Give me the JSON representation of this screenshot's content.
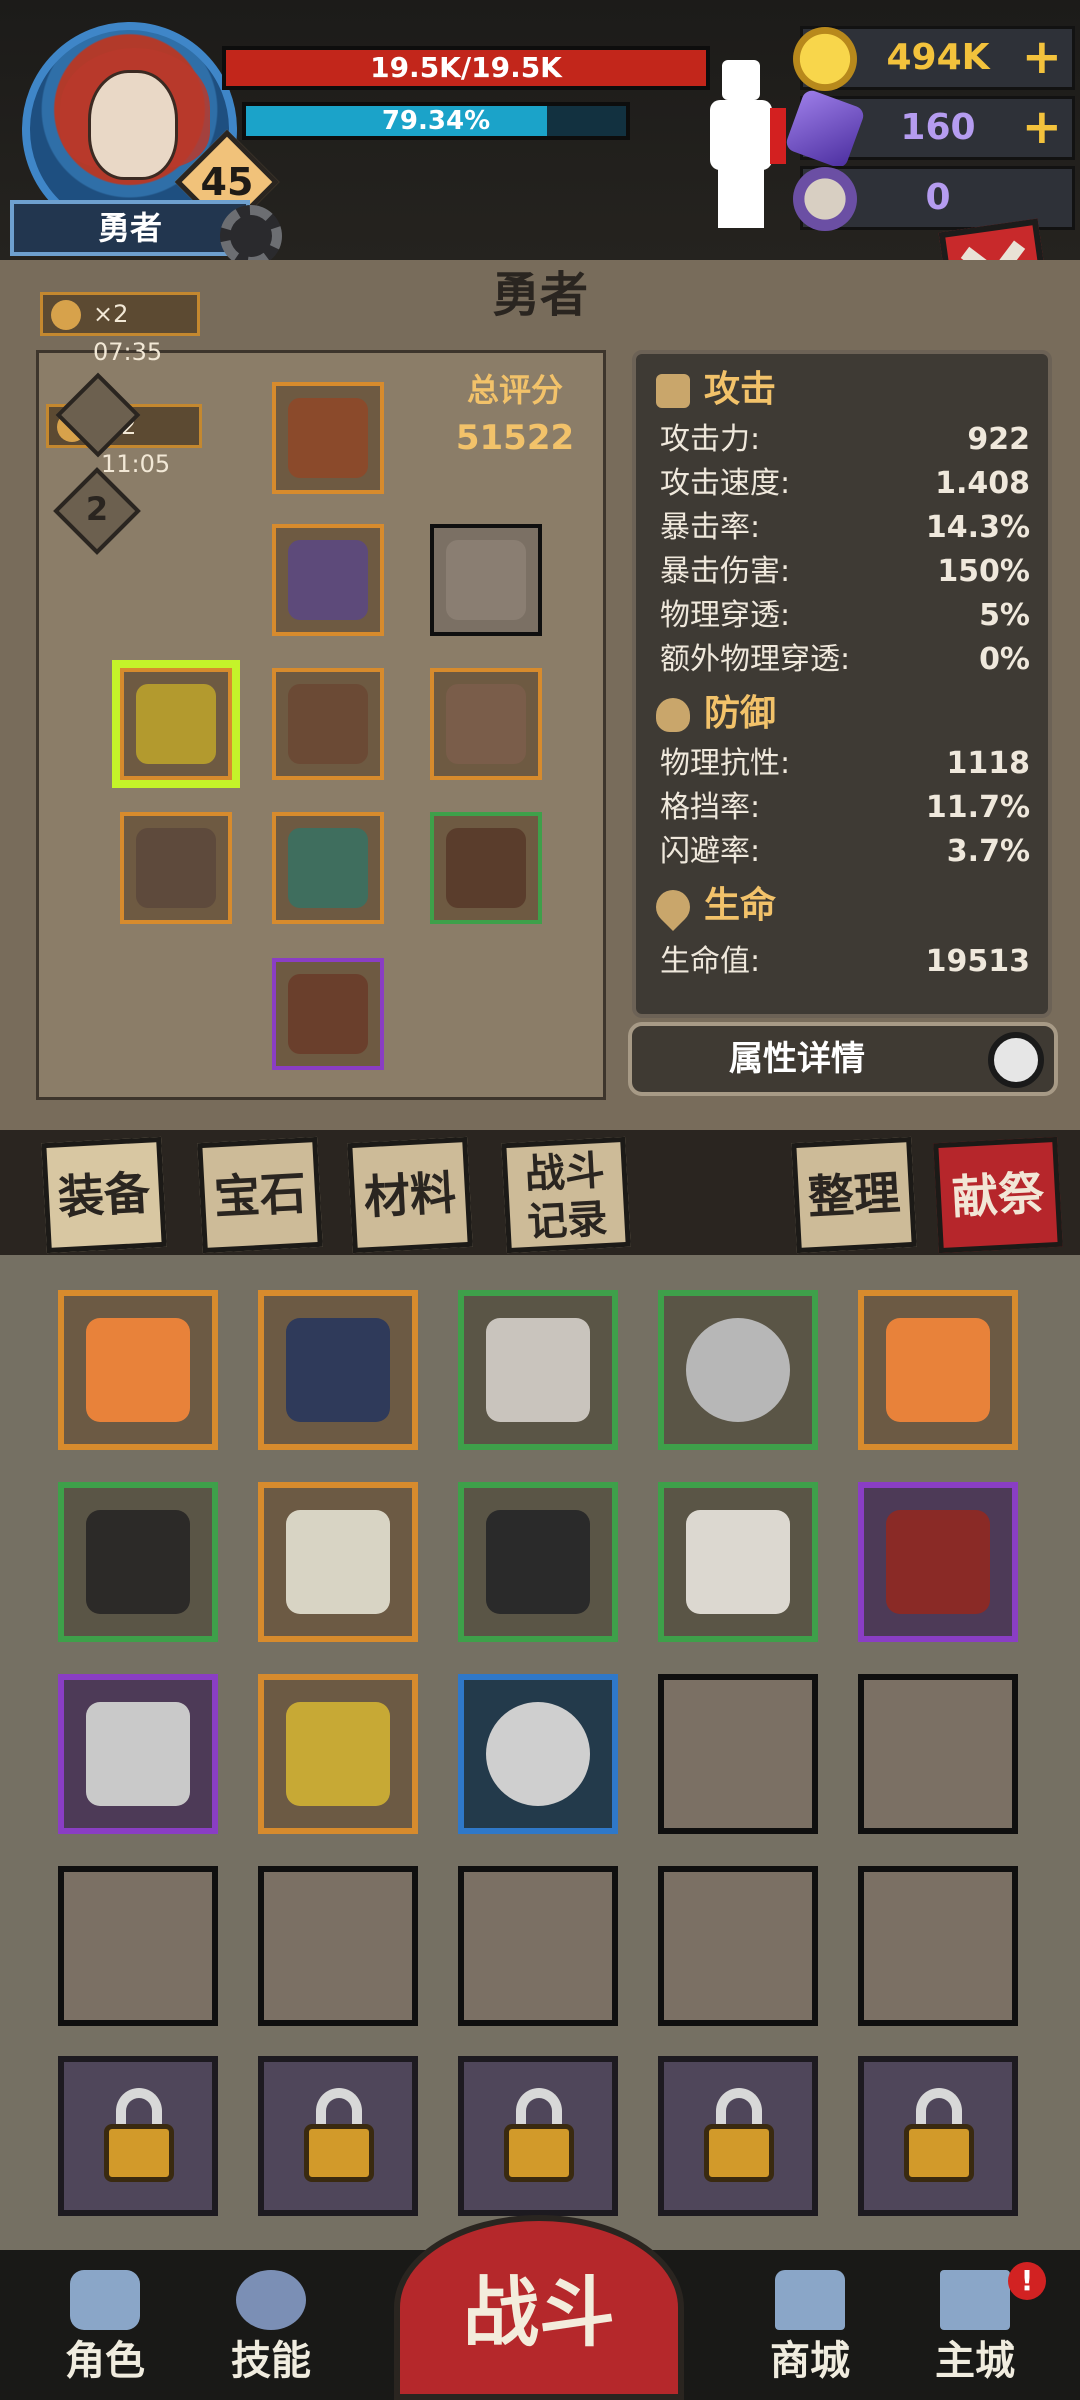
{
  "header": {
    "level": "45",
    "name": "勇者",
    "hp_text": "19.5K/19.5K",
    "hp_fraction": 1.0,
    "xp_text": "79.34%",
    "xp_fraction": 0.7934
  },
  "resources": {
    "gold": "494K",
    "gems": "160",
    "souls": "0",
    "plus": "+"
  },
  "panel": {
    "title": "勇者",
    "buff_timer_1": "×2 07:35",
    "buff_timer_2": "×2 11:05",
    "page_number": "2",
    "score_label": "总评分",
    "score_value": "51522"
  },
  "stats": {
    "attack_header": "攻击",
    "attack": [
      {
        "label": "攻击力:",
        "value": "922"
      },
      {
        "label": "攻击速度:",
        "value": "1.408"
      },
      {
        "label": "暴击率:",
        "value": "14.3%"
      },
      {
        "label": "暴击伤害:",
        "value": "150%"
      },
      {
        "label": "物理穿透:",
        "value": "5%"
      },
      {
        "label": "额外物理穿透:",
        "value": "0%"
      }
    ],
    "defense_header": "防御",
    "defense": [
      {
        "label": "物理抗性:",
        "value": "1118"
      },
      {
        "label": "格挡率:",
        "value": "11.7%"
      },
      {
        "label": "闪避率:",
        "value": "3.7%"
      }
    ],
    "life_header": "生命",
    "life": [
      {
        "label": "生命值:",
        "value": "19513"
      }
    ],
    "detail_button": "属性详情"
  },
  "tabs": {
    "equipment": "装备",
    "gems": "宝石",
    "materials": "材料",
    "battle_log": "战斗记录",
    "sort": "整理",
    "offer": "献祭"
  },
  "nav": {
    "character": "角色",
    "skills": "技能",
    "battle": "战斗",
    "shop": "商城",
    "main_city": "主城",
    "alert": "!"
  },
  "colors": {
    "hp": "#c2261b",
    "xp": "#1ba3c9",
    "highlight": "#c4f32a",
    "rarity_orange": "#d78b2d",
    "rarity_green": "#3ea04a",
    "rarity_blue": "#2f78c9",
    "rarity_purple": "#8a3ec4"
  }
}
